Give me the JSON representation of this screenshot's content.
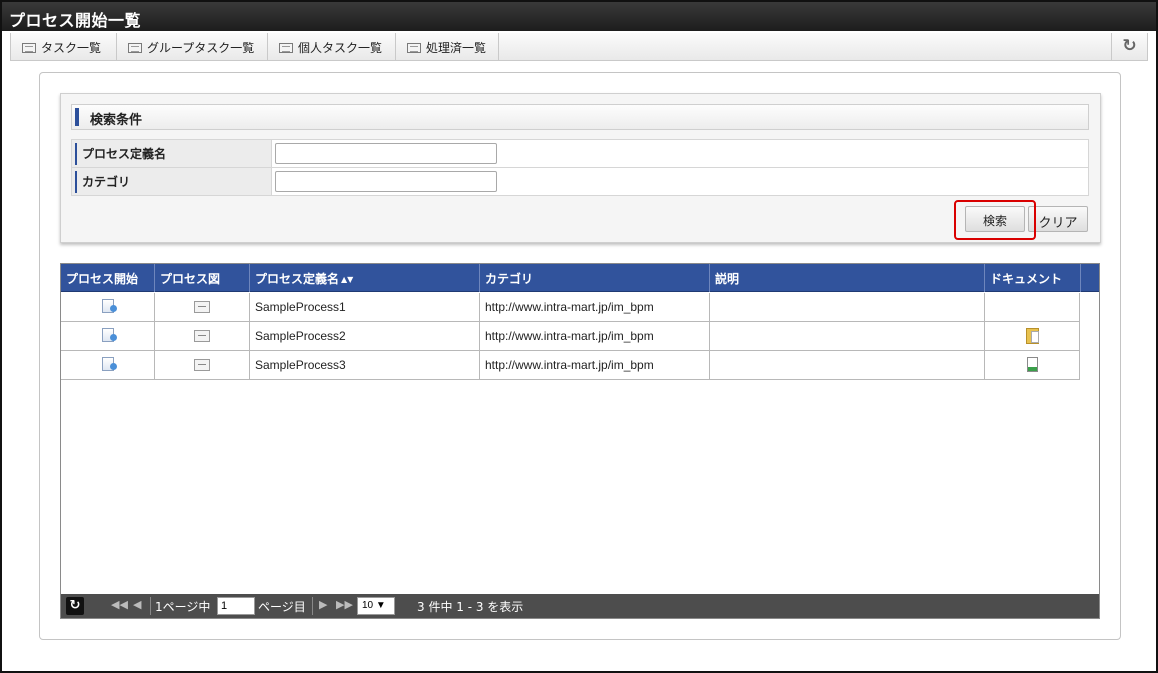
{
  "window": {
    "title": "プロセス開始一覧"
  },
  "tabs": [
    {
      "label": "タスク一覧"
    },
    {
      "label": "グループタスク一覧"
    },
    {
      "label": "個人タスク一覧"
    },
    {
      "label": "処理済一覧"
    }
  ],
  "search": {
    "header": "検索条件",
    "fields": [
      {
        "label": "プロセス定義名",
        "value": "",
        "placeholder": ""
      },
      {
        "label": "カテゴリ",
        "value": "",
        "placeholder": ""
      }
    ],
    "search_label": "検索",
    "clear_label": "クリア"
  },
  "grid": {
    "columns": [
      "プロセス開始",
      "プロセス図",
      "プロセス定義名",
      "カテゴリ",
      "説明",
      "ドキュメント"
    ],
    "sort_indicator": "▲▼",
    "rows": [
      {
        "name": "SampleProcess1",
        "category": "http://www.intra-mart.jp/im_bpm",
        "description": "",
        "document": ""
      },
      {
        "name": "SampleProcess2",
        "category": "http://www.intra-mart.jp/im_bpm",
        "description": "",
        "document": "folder-icon"
      },
      {
        "name": "SampleProcess3",
        "category": "http://www.intra-mart.jp/im_bpm",
        "description": "",
        "document": "file-icon"
      }
    ]
  },
  "pager": {
    "page_prefix": "1ページ中",
    "current_page": "1",
    "page_suffix": "ページ目",
    "rows_per_page": "10 ▼",
    "summary": "3 件中 1 - 3 を表示"
  },
  "colors": {
    "header_blue": "#31539c",
    "highlight_red": "#d90000",
    "titlebar": "#1d1d1d"
  }
}
